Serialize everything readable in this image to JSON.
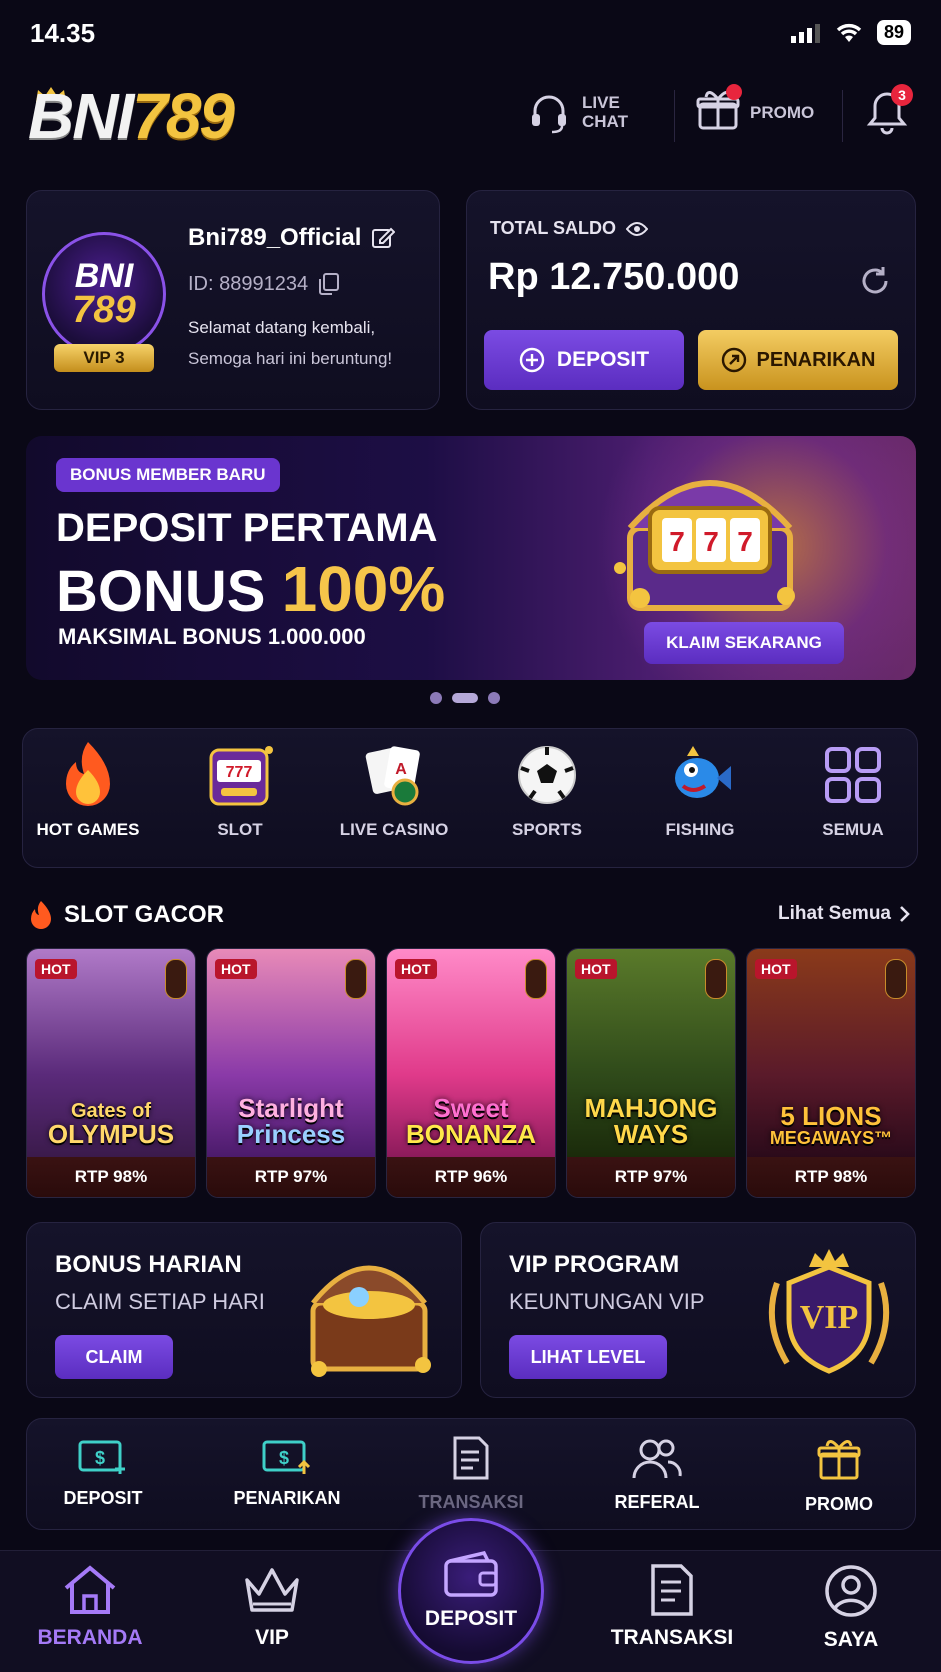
{
  "status": {
    "time": "14.35",
    "battery": "89"
  },
  "header": {
    "logo_white": "BNI",
    "logo_gold": "789",
    "live_chat_line1": "LIVE",
    "live_chat_line2": "CHAT",
    "promo_label": "PROMO",
    "notification_count": "3"
  },
  "profile": {
    "avatar_line1": "BNI",
    "avatar_line2": "789",
    "vip_label": "VIP 3",
    "username": "Bni789_Official",
    "id_text": "ID: 88991234",
    "welcome_line1": "Selamat datang kembali,",
    "welcome_line2": "Semoga hari ini beruntung!"
  },
  "balance": {
    "label": "TOTAL SALDO",
    "value": "Rp 12.750.000",
    "deposit_label": "DEPOSIT",
    "withdraw_label": "PENARIKAN"
  },
  "banner": {
    "pill": "BONUS MEMBER BARU",
    "line1": "DEPOSIT PERTAMA",
    "line2_word": "BONUS",
    "line2_pct": "100%",
    "line3": "MAKSIMAL BONUS 1.000.000",
    "cta": "KLAIM SEKARANG",
    "slot_digits": "777"
  },
  "categories": [
    {
      "label": "HOT GAMES",
      "icon": "fire-icon"
    },
    {
      "label": "SLOT",
      "icon": "slot-machine-icon"
    },
    {
      "label": "LIVE CASINO",
      "icon": "cards-icon"
    },
    {
      "label": "SPORTS",
      "icon": "soccer-ball-icon"
    },
    {
      "label": "FISHING",
      "icon": "fish-icon"
    },
    {
      "label": "SEMUA",
      "icon": "grid-icon"
    }
  ],
  "slot_gacor": {
    "title": "SLOT GACOR",
    "see_all": "Lihat Semua",
    "games": [
      {
        "hot": "HOT",
        "name1": "Gates of",
        "name2": "OLYMPUS",
        "rtp": "RTP 98%",
        "bg": "#6a4a8a"
      },
      {
        "hot": "HOT",
        "name1": "Starlight",
        "name2": "Princess",
        "rtp": "RTP 97%",
        "bg": "#7a3a7a"
      },
      {
        "hot": "HOT",
        "name1": "Sweet",
        "name2": "BONANZA",
        "rtp": "RTP 96%",
        "bg": "#c0408a"
      },
      {
        "hot": "HOT",
        "name1": "MAHJONG",
        "name2": "WAYS",
        "rtp": "RTP 97%",
        "bg": "#2f4a1a"
      },
      {
        "hot": "HOT",
        "name1": "5 LIONS",
        "name2": "MEGAWAYS™",
        "rtp": "RTP 98%",
        "bg": "#4a1a2a"
      }
    ]
  },
  "promo_cards": {
    "daily_title": "BONUS HARIAN",
    "daily_sub": "CLAIM SETIAP HARI",
    "daily_btn": "CLAIM",
    "vip_title": "VIP PROGRAM",
    "vip_sub": "KEUNTUNGAN VIP",
    "vip_btn": "LIHAT LEVEL",
    "vip_badge": "VIP"
  },
  "quick_actions": [
    {
      "label": "DEPOSIT",
      "icon": "deposit-cash-icon"
    },
    {
      "label": "PENARIKAN",
      "icon": "withdraw-cash-icon"
    },
    {
      "label": "TRANSAKSI",
      "icon": "transaction-doc-icon"
    },
    {
      "label": "REFERAL",
      "icon": "referral-users-icon"
    },
    {
      "label": "PROMO",
      "icon": "gift-icon"
    }
  ],
  "bottom_nav": {
    "home": "BERANDA",
    "vip": "VIP",
    "deposit": "DEPOSIT",
    "transactions": "TRANSAKSI",
    "me": "SAYA"
  },
  "colors": {
    "accent": "#7b4be3",
    "gold": "#f3c440",
    "bg": "#0a0816"
  }
}
